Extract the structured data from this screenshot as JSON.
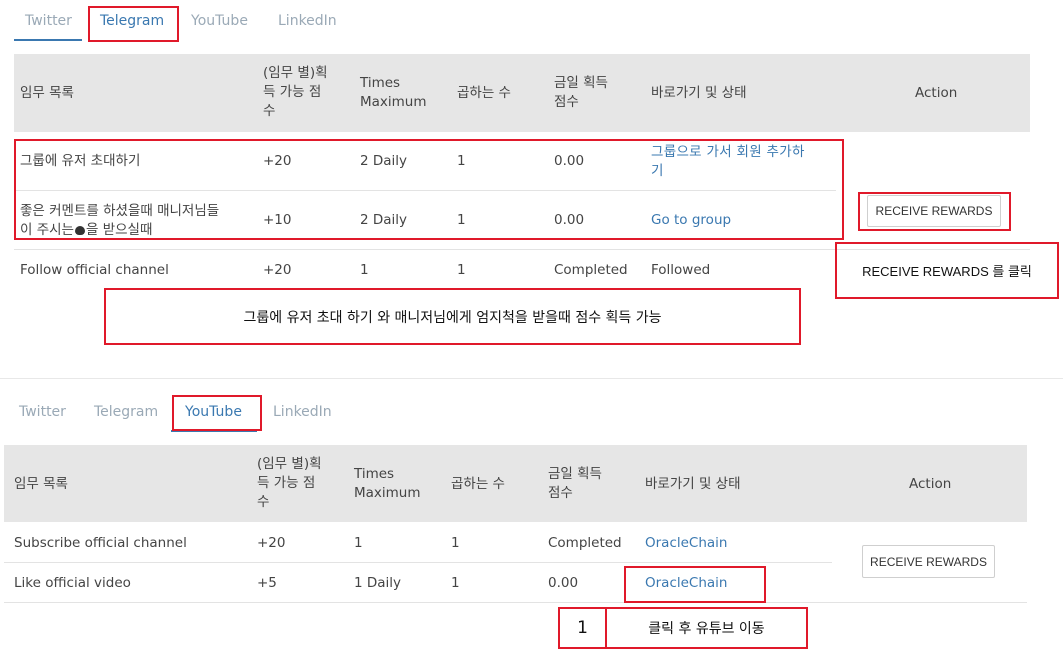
{
  "top": {
    "tabs": [
      "Twitter",
      "Telegram",
      "YouTube",
      "LinkedIn"
    ],
    "headers": {
      "task": "임무 목록",
      "points": "(임무 별)획\n득 가능 점\n수",
      "times": "Times\nMaximum",
      "multiplier": "곱하는 수",
      "today": "금일 획득\n점수",
      "shortcut": "바로가기 및 상태",
      "action": "Action"
    },
    "rows": [
      {
        "task": "그룹에 유저 초대하기",
        "points": "+20",
        "times": "2 Daily",
        "multiplier": "1",
        "today": "0.00",
        "shortcut": "그룹으로 가서 회원 추가하\n기"
      },
      {
        "task_line1": "좋은 커멘트를 하셨을때 매니저님들",
        "task_line2a": "이 주시는",
        "task_line2b": "을 받으실때",
        "points": "+10",
        "times": "2 Daily",
        "multiplier": "1",
        "today": "0.00",
        "shortcut": "Go to group"
      },
      {
        "task": "Follow official channel",
        "points": "+20",
        "times": "1",
        "multiplier": "1",
        "today": "Completed",
        "shortcut": "Followed"
      }
    ],
    "button": "RECEIVE REWARDS",
    "note_click": "RECEIVE REWARDS 를 클릭",
    "note_main": "그룹에 유저 초대 하기 와 매니저님에게 엄지척을 받을때 점수 획득 가능"
  },
  "bottom": {
    "tabs": [
      "Twitter",
      "Telegram",
      "YouTube",
      "LinkedIn"
    ],
    "headers": {
      "task": "임무 목록",
      "points": "(임무 별)획\n득 가능 점\n수",
      "times": "Times\nMaximum",
      "multiplier": "곱하는 수",
      "today": "금일 획득\n점수",
      "shortcut": "바로가기 및 상태",
      "action": "Action"
    },
    "rows": [
      {
        "task": "Subscribe official channel",
        "points": "+20",
        "times": "1",
        "multiplier": "1",
        "today": "Completed",
        "shortcut": "OracleChain"
      },
      {
        "task": "Like official video",
        "points": "+5",
        "times": "1 Daily",
        "multiplier": "1",
        "today": "0.00",
        "shortcut": "OracleChain"
      }
    ],
    "button": "RECEIVE REWARDS",
    "step_number": "1",
    "step_note": "클릭 후 유튜브 이동"
  },
  "colors": {
    "accent": "#3a78b0",
    "annotation": "#e0192a",
    "header_bg": "#e6e6e6"
  }
}
